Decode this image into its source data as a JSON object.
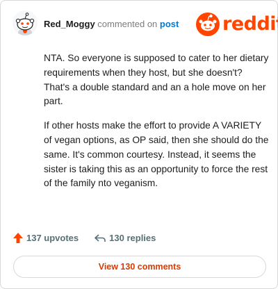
{
  "comment": {
    "username": "Red_Moggy",
    "commented_text": "commented on",
    "post_link": "post",
    "paragraphs": [
      "NTA. So everyone is supposed to cater to her dietary requirements when they host, but she doesn't? That's a double standard and an a hole move on her part.",
      "If other hosts make the effort to provide A VARIETY of vegan options, as OP said, then she should do the same. It's common courtesy. Instead, it seems the sister is taking this as an opportunity to force the rest of the family nto veganism."
    ],
    "upvotes": "137 upvotes",
    "replies": "130 replies",
    "view_comments_label": "View 130 comments"
  },
  "brand": {
    "wordmark": "reddit",
    "color": "#ff4500"
  },
  "icons": {
    "upvote": "arrow-up-icon",
    "reply": "reply-arrow-icon"
  }
}
